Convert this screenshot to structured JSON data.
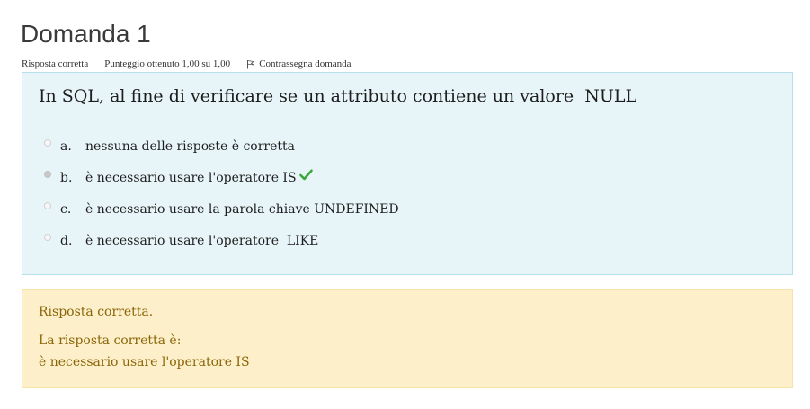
{
  "question": {
    "title": "Domanda 1",
    "info": {
      "state": "Risposta corretta",
      "grade": "Punteggio ottenuto 1,00 su 1,00",
      "flag_label": "Contrassegna domanda"
    },
    "text": "In SQL, al fine di verificare se un attributo contiene un valore  NULL",
    "answers": [
      {
        "letter": "a.",
        "text": "nessuna delle risposte è corretta",
        "selected": false
      },
      {
        "letter": "b.",
        "text": "è necessario usare l'operatore IS",
        "selected": true,
        "correct": true
      },
      {
        "letter": "c.",
        "text": "è necessario usare la parola chiave UNDEFINED",
        "selected": false
      },
      {
        "letter": "d.",
        "text": "è necessario usare l'operatore  LIKE",
        "selected": false
      }
    ]
  },
  "feedback": {
    "result": "Risposta corretta.",
    "correct_answer_label": "La risposta corretta è:",
    "correct_answer": "è necessario usare l'operatore IS"
  },
  "colors": {
    "question_bg": "#e7f5f8",
    "feedback_bg": "#fcefc9",
    "feedback_text": "#8b6508",
    "check": "#3aa53a"
  },
  "icons": {
    "flag": "flag-icon",
    "correct": "check-icon"
  }
}
